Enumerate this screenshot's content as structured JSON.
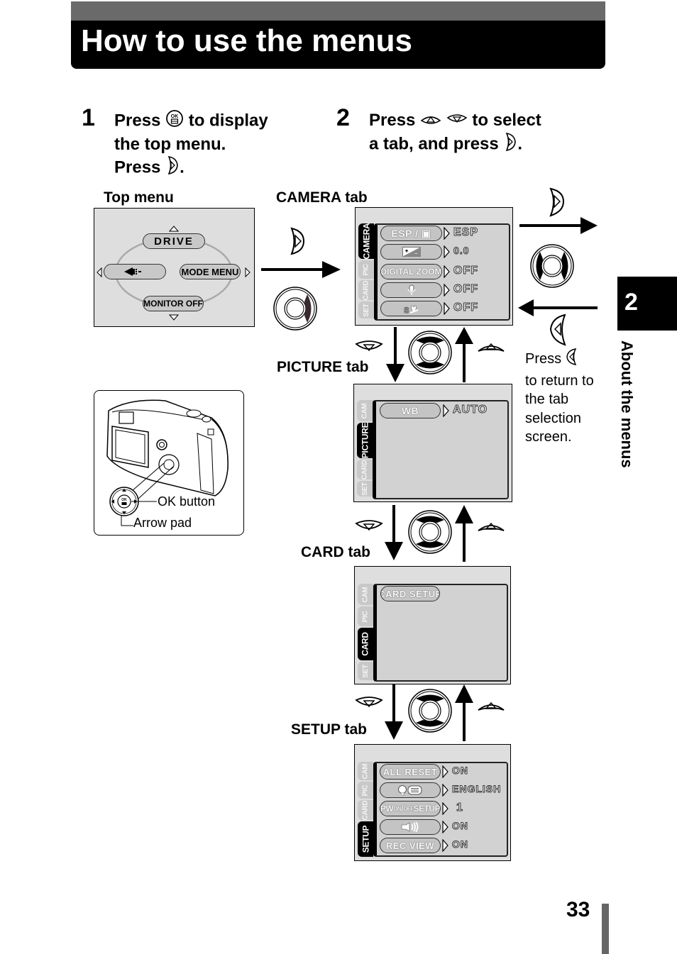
{
  "header": {
    "title": "How to use the menus"
  },
  "steps": [
    {
      "number": "1",
      "lines": [
        "Press",
        "to display",
        "the top menu.",
        "Press",
        "."
      ],
      "icons": [
        "ok-button-icon",
        "right-arrow-button-icon"
      ]
    },
    {
      "number": "2",
      "lines": [
        "Press",
        "to select",
        "a tab, and press",
        "."
      ],
      "icons": [
        "up-arrow-button-icon",
        "down-arrow-button-icon",
        "right-arrow-button-icon"
      ]
    }
  ],
  "top_menu": {
    "label": "Top menu",
    "items": {
      "up": "DRIVE",
      "left_icon": "image-quality-icon",
      "right": "MODE MENU",
      "down": "MONITOR OFF"
    }
  },
  "camera_illustration": {
    "ok_label": "OK button",
    "arrow_label": "Arrow pad"
  },
  "tabs": {
    "camera": {
      "label": "CAMERA tab",
      "tab_names": [
        "CAMERA",
        "PIC",
        "CARD",
        "SET"
      ],
      "items": [
        {
          "name": "ESP / ▣",
          "value": "ESP"
        },
        {
          "name": "+/- exposure",
          "icon": "exposure-compensation-icon",
          "value": "0.0"
        },
        {
          "name": "DIGITAL ZOOM",
          "value": "OFF"
        },
        {
          "name": "microphone",
          "icon": "microphone-icon",
          "value": "OFF"
        },
        {
          "name": "super macro",
          "icon": "super-macro-icon",
          "value": "OFF"
        }
      ]
    },
    "picture": {
      "label": "PICTURE tab",
      "tab_names": [
        "CAM",
        "PICTURE",
        "CARD",
        "SET"
      ],
      "items": [
        {
          "name": "WB",
          "value": "AUTO"
        }
      ]
    },
    "card": {
      "label": "CARD tab",
      "tab_names": [
        "CAM",
        "PIC",
        "CARD",
        "SET"
      ],
      "items": [
        {
          "name": "CARD SETUP"
        }
      ]
    },
    "setup": {
      "label": "SETUP tab",
      "tab_names": [
        "CAM",
        "PIC",
        "CARD",
        "SETUP"
      ],
      "items": [
        {
          "name": "ALL RESET",
          "value": "ON"
        },
        {
          "name": "language",
          "icon": "language-icon",
          "value": "ENGLISH"
        },
        {
          "name": "PW ON/OFF SETUP",
          "value": "1"
        },
        {
          "name": "beep",
          "icon": "beep-icon",
          "value": "ON"
        },
        {
          "name": "REC VIEW",
          "value": "ON"
        }
      ]
    }
  },
  "return_note": {
    "lines": [
      "Press",
      "to return to",
      "the tab",
      "selection",
      "screen."
    ]
  },
  "side_tab": {
    "number": "2",
    "label": "About the menus"
  },
  "page_number": "33",
  "colors": {
    "title_strip": "#6a6a6a",
    "title_bg": "#000000",
    "screen_bg": "#dedede",
    "page_bar": "#666666"
  }
}
